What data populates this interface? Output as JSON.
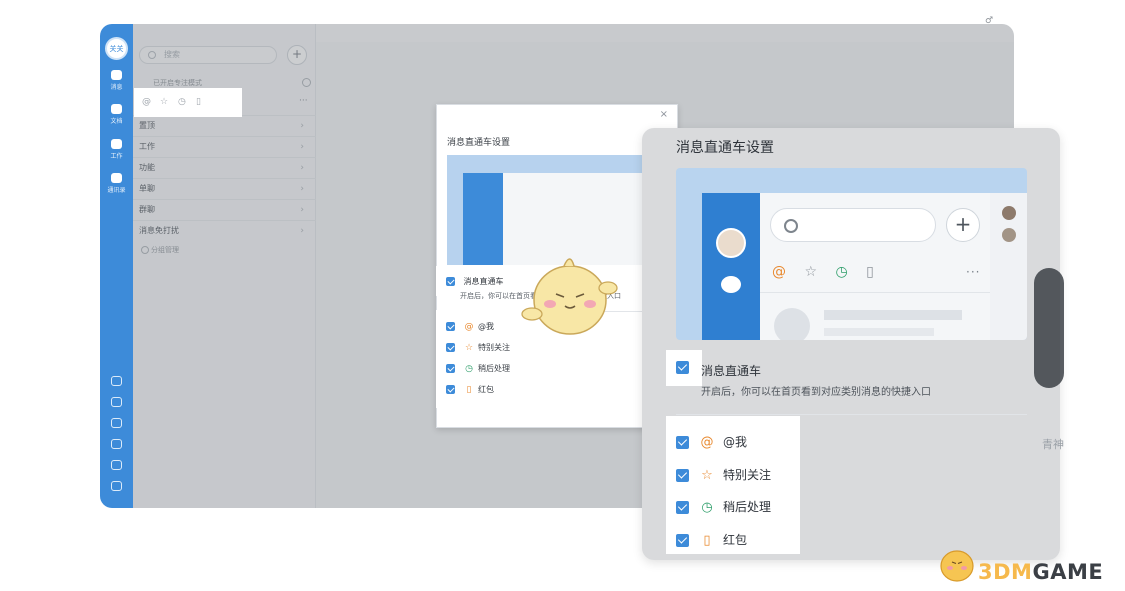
{
  "app": {
    "avatar_label": "关关",
    "rail": [
      {
        "label": "消息"
      },
      {
        "label": "文档"
      },
      {
        "label": "工作"
      },
      {
        "label": "通讯录"
      }
    ],
    "search_placeholder": "搜索",
    "plus": "+",
    "focus_mode": "已开启专注模式",
    "categories": [
      "置顶",
      "工作",
      "功能",
      "单聊",
      "群聊",
      "消息免打扰"
    ],
    "group_manage": "分组管理",
    "more": "···"
  },
  "small_dialog": {
    "close": "×",
    "title": "消息直通车设置",
    "main_option": "消息直通车",
    "hint": "开启后，你可以在首页看到对应类别消息的快捷入口",
    "options": [
      {
        "icon": "@",
        "label": "@我"
      },
      {
        "icon": "☆",
        "label": "特别关注"
      },
      {
        "icon": "◷",
        "label": "稍后处理"
      },
      {
        "icon": "▯",
        "label": "红包"
      }
    ]
  },
  "big_dialog": {
    "title": "消息直通车设置",
    "main_option": "消息直通车",
    "hint": "开启后，你可以在首页看到对应类别消息的快捷入口",
    "preview_plus": "+",
    "preview_more": "···",
    "options": [
      {
        "icon": "@",
        "label": "@我",
        "color": "#e8892f"
      },
      {
        "icon": "☆",
        "label": "特别关注",
        "color": "#e8892f"
      },
      {
        "icon": "◷",
        "label": "稍后处理",
        "color": "#2e9e6a"
      },
      {
        "icon": "▯",
        "label": "红包",
        "color": "#e8892f"
      }
    ]
  },
  "side_text": "青神",
  "brand": {
    "a": "3DM",
    "b": "GAME"
  },
  "colors": {
    "accent": "#3d8bd9",
    "orange": "#e8892f",
    "green": "#2e9e6a",
    "brand": "#f6b94c"
  }
}
